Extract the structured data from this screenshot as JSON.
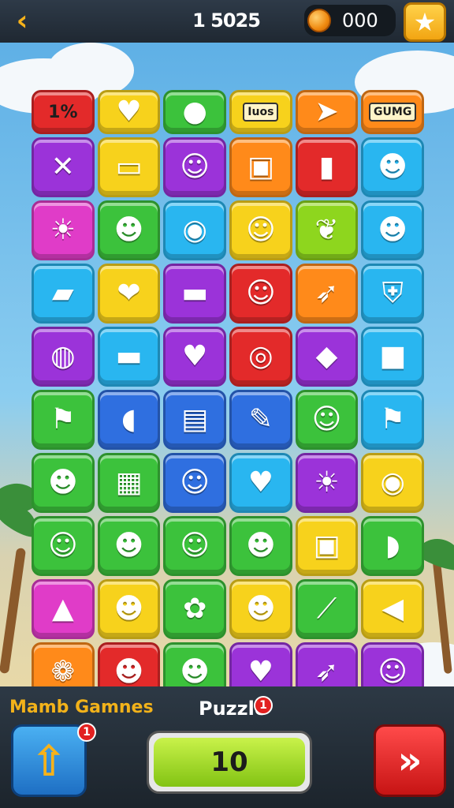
{
  "topbar": {
    "back_icon": "back-chevron-icon",
    "back_glyph": "‹",
    "score": "1 5025",
    "coins": "000",
    "coin_icon": "coin-icon",
    "star_icon": "star-icon",
    "star_glyph": "★"
  },
  "colors": {
    "red": "#e32a2a",
    "yellow": "#f7d21c",
    "green": "#3cc23c",
    "orange": "#ff8a1a",
    "purple": "#9b33d9",
    "cyan": "#29b6f0",
    "blue": "#2f6fe0",
    "magenta": "#e03cc8",
    "lime": "#8ed61e"
  },
  "board": {
    "rows": [
      [
        {
          "color": "red",
          "label": "1%",
          "name": "percent-tile"
        },
        {
          "color": "yellow",
          "icon": "♥",
          "name": "heart-icon"
        },
        {
          "color": "green",
          "icon": "●",
          "name": "ball-icon"
        },
        {
          "color": "yellow",
          "label": "Iuos",
          "small": true,
          "name": "label-tile"
        },
        {
          "color": "orange",
          "icon": "➤",
          "name": "arrow-icon"
        },
        {
          "color": "orange",
          "label": "GUMG",
          "small": true,
          "name": "label-tile"
        }
      ],
      [
        {
          "color": "purple",
          "icon": "✕",
          "name": "rocket-icon"
        },
        {
          "color": "yellow",
          "icon": "▭",
          "name": "cart-icon"
        },
        {
          "color": "purple",
          "icon": "☺",
          "name": "cat-icon"
        },
        {
          "color": "orange",
          "icon": "▣",
          "name": "bag-icon"
        },
        {
          "color": "red",
          "icon": "▮",
          "name": "phone-icon"
        },
        {
          "color": "cyan",
          "icon": "☻",
          "name": "fox-icon"
        }
      ],
      [
        {
          "color": "magenta",
          "icon": "☀",
          "name": "sun-icon"
        },
        {
          "color": "green",
          "icon": "☻",
          "name": "cat-icon"
        },
        {
          "color": "cyan",
          "icon": "◉",
          "name": "log-icon"
        },
        {
          "color": "yellow",
          "icon": "☺",
          "name": "cat-icon"
        },
        {
          "color": "lime",
          "icon": "❦",
          "name": "leaf-icon"
        },
        {
          "color": "cyan",
          "icon": "☻",
          "name": "dragon-icon"
        }
      ],
      [
        {
          "color": "cyan",
          "icon": "▰",
          "name": "popsicle-icon"
        },
        {
          "color": "yellow",
          "icon": "❤",
          "name": "carrot-icon"
        },
        {
          "color": "purple",
          "icon": "▬",
          "name": "flag-icon"
        },
        {
          "color": "red",
          "icon": "☺",
          "name": "cat-icon"
        },
        {
          "color": "orange",
          "icon": "➶",
          "name": "carrot-icon"
        },
        {
          "color": "cyan",
          "icon": "⛨",
          "name": "shield-icon"
        }
      ],
      [
        {
          "color": "purple",
          "icon": "◍",
          "name": "candy-icon"
        },
        {
          "color": "cyan",
          "icon": "▬",
          "name": "monitor-icon"
        },
        {
          "color": "purple",
          "icon": "♥",
          "name": "heart-icon"
        },
        {
          "color": "red",
          "icon": "◎",
          "name": "tomato-icon"
        },
        {
          "color": "purple",
          "icon": "◆",
          "name": "gem-icon"
        },
        {
          "color": "cyan",
          "icon": "■",
          "name": "block-icon"
        }
      ],
      [
        {
          "color": "green",
          "icon": "⚑",
          "name": "flag-icon"
        },
        {
          "color": "blue",
          "icon": "◖",
          "name": "capsule-icon"
        },
        {
          "color": "blue",
          "icon": "▤",
          "name": "flag-icon"
        },
        {
          "color": "blue",
          "icon": "✎",
          "name": "card-icon"
        },
        {
          "color": "green",
          "icon": "☺",
          "name": "cat-icon"
        },
        {
          "color": "cyan",
          "icon": "⚑",
          "name": "flag-icon"
        }
      ],
      [
        {
          "color": "green",
          "icon": "☻",
          "name": "turtle-icon"
        },
        {
          "color": "green",
          "icon": "▦",
          "name": "box-icon"
        },
        {
          "color": "blue",
          "icon": "☺",
          "name": "cat-icon"
        },
        {
          "color": "cyan",
          "icon": "♥",
          "name": "heart-icon"
        },
        {
          "color": "purple",
          "icon": "☀",
          "name": "sun-icon"
        },
        {
          "color": "yellow",
          "icon": "◉",
          "name": "target-icon"
        }
      ],
      [
        {
          "color": "green",
          "icon": "☺",
          "name": "cat-icon"
        },
        {
          "color": "green",
          "icon": "☻",
          "name": "face-icon"
        },
        {
          "color": "green",
          "icon": "☺",
          "name": "cat-icon"
        },
        {
          "color": "green",
          "icon": "☻",
          "name": "frog-icon"
        },
        {
          "color": "yellow",
          "icon": "▣",
          "name": "radio-icon"
        },
        {
          "color": "green",
          "icon": "◗",
          "name": "hippo-icon"
        }
      ],
      [
        {
          "color": "magenta",
          "icon": "▲",
          "name": "pyramid-icon"
        },
        {
          "color": "yellow",
          "icon": "☻",
          "name": "bird-icon"
        },
        {
          "color": "green",
          "icon": "✿",
          "name": "flower-icon"
        },
        {
          "color": "yellow",
          "icon": "☻",
          "name": "monster-icon"
        },
        {
          "color": "green",
          "icon": "⟋",
          "name": "banana-icon"
        },
        {
          "color": "yellow",
          "icon": "◀",
          "name": "leaf-icon"
        }
      ],
      [
        {
          "color": "orange",
          "icon": "❁",
          "name": "sheep-icon"
        },
        {
          "color": "red",
          "icon": "☻",
          "name": "deer-icon"
        },
        {
          "color": "green",
          "icon": "☻",
          "name": "bear-icon"
        },
        {
          "color": "purple",
          "icon": "♥",
          "name": "heart-icon"
        },
        {
          "color": "purple",
          "icon": "➶",
          "name": "carrot-icon"
        },
        {
          "color": "purple",
          "icon": "☺",
          "name": "face-icon"
        }
      ]
    ]
  },
  "bottombar": {
    "title": "Mamb Gamnes",
    "puzzle_label": "Puzzle",
    "puzzle_badge": "1",
    "upgrade_badge": "1",
    "upgrade_icon": "arrow-up-icon",
    "upgrade_glyph": "⇧",
    "level_value": "10",
    "next_icon": "double-chevron-right-icon",
    "next_glyph": "»"
  }
}
